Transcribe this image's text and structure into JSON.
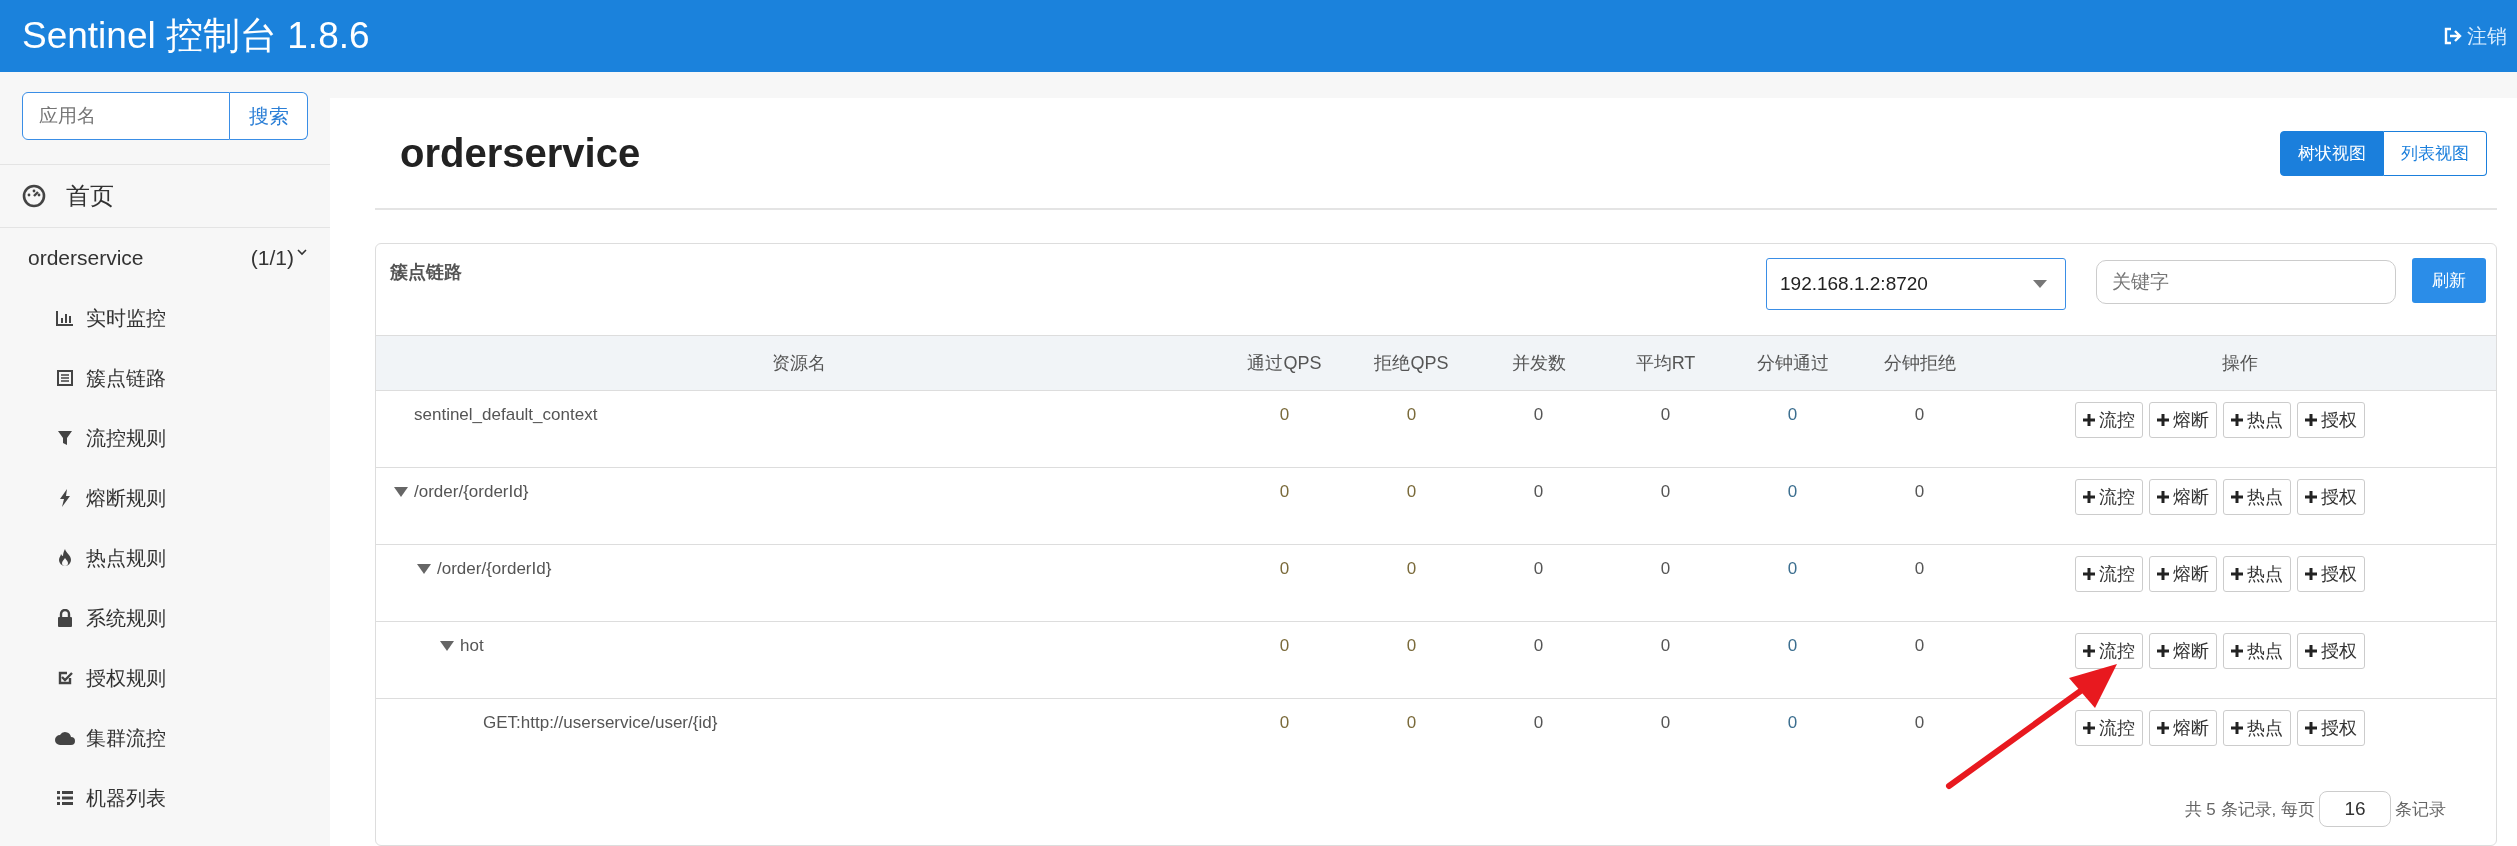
{
  "header": {
    "title": "Sentinel 控制台 1.8.6",
    "logout": "注销"
  },
  "sidebar": {
    "search": {
      "placeholder": "应用名",
      "button": "搜索"
    },
    "home": "首页",
    "app": {
      "name": "orderservice",
      "count": "(1/1)",
      "expanded": true,
      "items": [
        {
          "label": "实时监控",
          "kind": "chart"
        },
        {
          "label": "簇点链路",
          "kind": "list"
        },
        {
          "label": "流控规则",
          "kind": "filter"
        },
        {
          "label": "熔断规则",
          "kind": "bolt"
        },
        {
          "label": "热点规则",
          "kind": "fire"
        },
        {
          "label": "系统规则",
          "kind": "lock"
        },
        {
          "label": "授权规则",
          "kind": "check"
        },
        {
          "label": "集群流控",
          "kind": "cloud"
        },
        {
          "label": "机器列表",
          "kind": "menu"
        }
      ]
    }
  },
  "main": {
    "title": "orderservice",
    "views": [
      {
        "label": "树状视图",
        "selected": true
      },
      {
        "label": "列表视图",
        "selected": false
      }
    ],
    "card": {
      "title": "簇点链路",
      "machine_select": {
        "value": "192.168.1.2:8720"
      },
      "keyword": {
        "placeholder": "关键字"
      },
      "refresh": "刷新",
      "columns": [
        "资源名",
        "通过QPS",
        "拒绝QPS",
        "并发数",
        "平均RT",
        "分钟通过",
        "分钟拒绝",
        "操作"
      ],
      "rows": [
        {
          "name": "sentinel_default_context",
          "values": [
            "0",
            "0",
            "0",
            "0",
            "0",
            "0"
          ],
          "actions": [
            "流控",
            "熔断",
            "热点",
            "授权"
          ]
        },
        {
          "name": "/order/{orderId}",
          "values": [
            "0",
            "0",
            "0",
            "0",
            "0",
            "0"
          ],
          "actions": [
            "流控",
            "熔断",
            "热点",
            "授权"
          ],
          "expanded": true,
          "children": [
            {
              "name": "/order/{orderId}",
              "values": [
                "0",
                "0",
                "0",
                "0",
                "0",
                "0"
              ],
              "actions": [
                "流控",
                "熔断",
                "热点",
                "授权"
              ],
              "expanded": true,
              "children": [
                {
                  "name": "hot",
                  "values": [
                    "0",
                    "0",
                    "0",
                    "0",
                    "0",
                    "0"
                  ],
                  "actions": [
                    "流控",
                    "熔断",
                    "热点",
                    "授权"
                  ],
                  "expanded": true,
                  "children": [
                    {
                      "name": "GET:http://userservice/user/{id}",
                      "values": [
                        "0",
                        "0",
                        "0",
                        "0",
                        "0",
                        "0"
                      ],
                      "actions": [
                        "流控",
                        "熔断",
                        "热点",
                        "授权"
                      ]
                    }
                  ]
                }
              ]
            }
          ]
        }
      ],
      "pagination": {
        "before": "共 5 条记录, 每页",
        "page_size": "16",
        "after": "条记录"
      }
    }
  }
}
